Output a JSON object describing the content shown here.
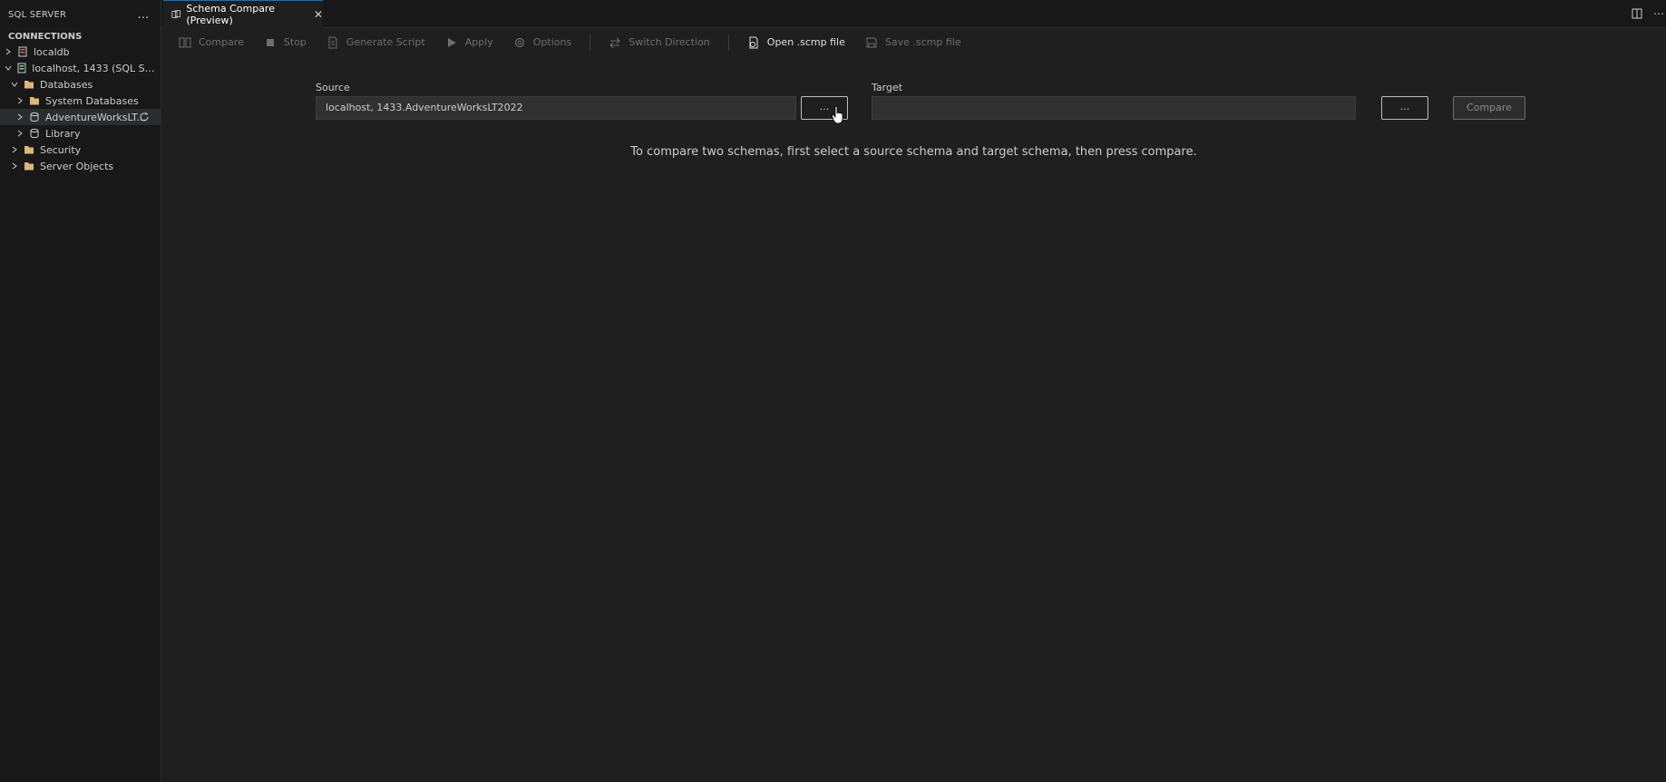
{
  "sidebar": {
    "title": "SQL SERVER",
    "more_icon": "...",
    "section": "CONNECTIONS",
    "tree": [
      {
        "label": "localdb",
        "icon": "server-icon"
      },
      {
        "label": "localhost, 1433 (SQL Serv...",
        "icon": "server-connected-icon"
      },
      {
        "label": "Databases",
        "icon": "folder-icon"
      },
      {
        "label": "System Databases",
        "icon": "folder-icon"
      },
      {
        "label": "AdventureWorksLT...",
        "icon": "database-icon"
      },
      {
        "label": "Library",
        "icon": "database-icon"
      },
      {
        "label": "Security",
        "icon": "folder-icon"
      },
      {
        "label": "Server Objects",
        "icon": "folder-icon"
      }
    ]
  },
  "tab": {
    "title": "Schema Compare (Preview)",
    "close": "✕"
  },
  "toolbar": {
    "compare": "Compare",
    "stop": "Stop",
    "generate_script": "Generate Script",
    "apply": "Apply",
    "options": "Options",
    "switch_direction": "Switch Direction",
    "open_scmp": "Open .scmp file",
    "save_scmp": "Save .scmp file"
  },
  "source": {
    "label": "Source",
    "value": "localhost, 1433.AdventureWorksLT2022",
    "browse": "..."
  },
  "target": {
    "label": "Target",
    "value": "",
    "browse": "..."
  },
  "compare_button": "Compare",
  "hint": "To compare two schemas, first select a source schema and target schema, then press compare.",
  "colors": {
    "accent": "#0078d4",
    "background": "#1f1f1f",
    "sidebar": "#181818",
    "folder": "#dcb67a"
  }
}
